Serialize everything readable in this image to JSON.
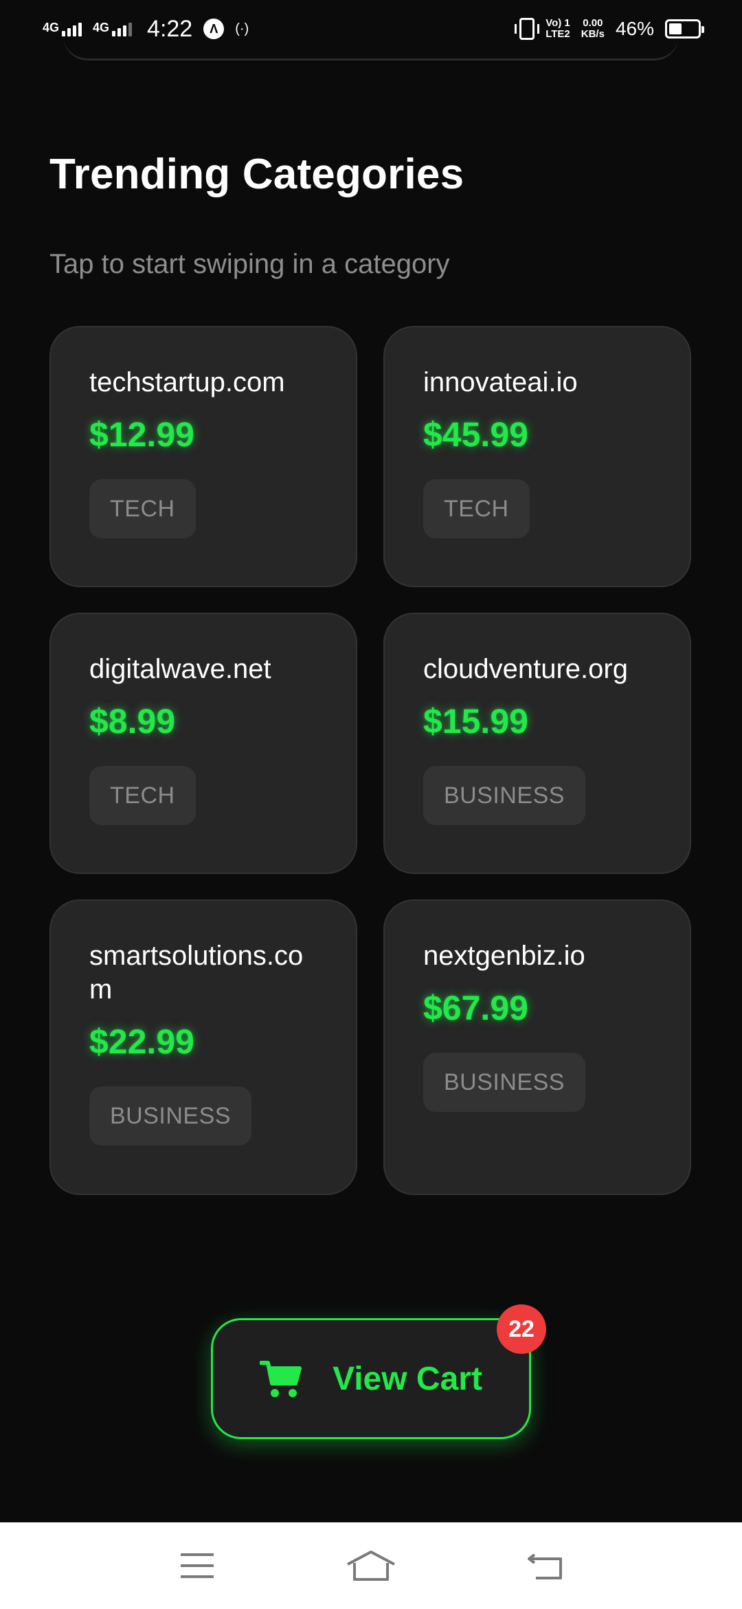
{
  "status_bar": {
    "net1": "4G",
    "net2": "4G",
    "time": "4:22",
    "volte": "Vo) 1\nLTE2",
    "speed": "0.00\nKB/s",
    "battery_percent": "46%",
    "battery_level": 0.46
  },
  "section": {
    "title": "Trending Categories",
    "subtitle": "Tap to start swiping in a category"
  },
  "cards": [
    {
      "domain": "techstartup.com",
      "price": "$12.99",
      "category": "TECH"
    },
    {
      "domain": "innovateai.io",
      "price": "$45.99",
      "category": "TECH"
    },
    {
      "domain": "digitalwave.net",
      "price": "$8.99",
      "category": "TECH"
    },
    {
      "domain": "cloudventure.org",
      "price": "$15.99",
      "category": "BUSINESS"
    },
    {
      "domain": "smartsolutions.com",
      "price": "$22.99",
      "category": "BUSINESS"
    },
    {
      "domain": "nextgenbiz.io",
      "price": "$67.99",
      "category": "BUSINESS"
    }
  ],
  "cart": {
    "label": "View Cart",
    "badge_count": "22",
    "icon": "cart-icon"
  },
  "colors": {
    "accent_green": "#22e84a",
    "badge_red": "#ee3b3b",
    "card_bg": "#262626",
    "background": "#0b0b0b"
  },
  "nav_bar": {
    "icons": [
      "menu-icon",
      "home-icon",
      "back-icon"
    ]
  }
}
